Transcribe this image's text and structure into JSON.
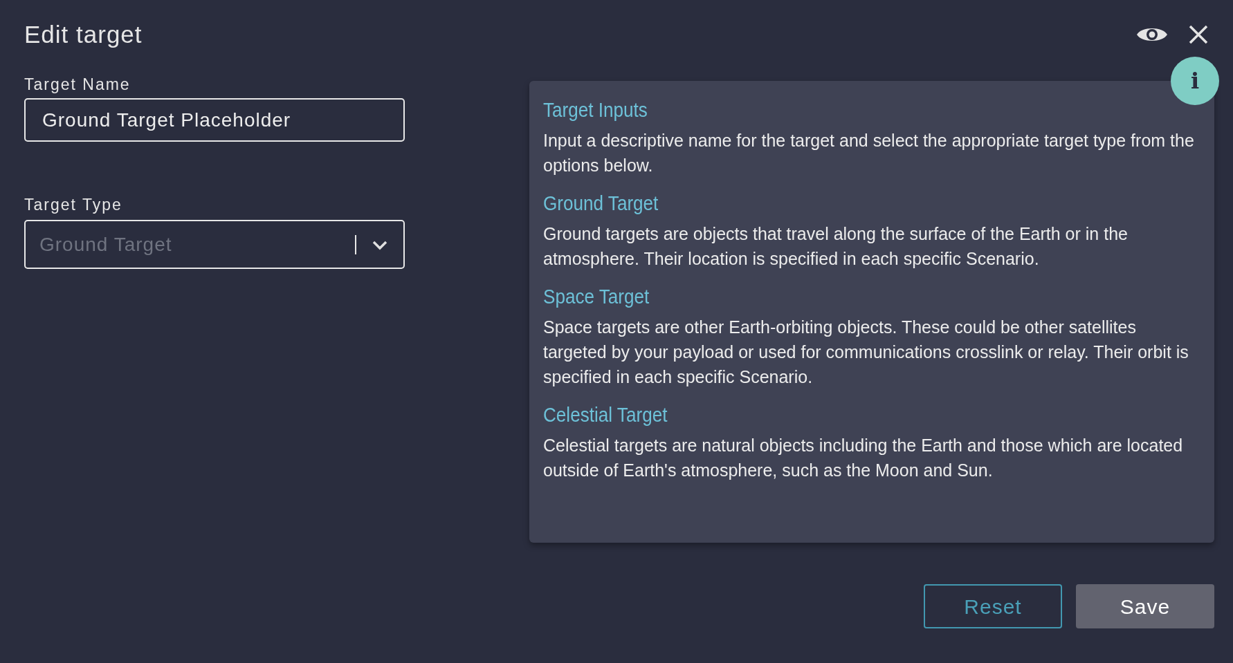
{
  "dialog": {
    "title": "Edit target"
  },
  "fields": [
    {
      "kind": "text",
      "label": "Target Name",
      "value": "Ground Target Placeholder"
    },
    {
      "kind": "select",
      "label": "Target Type",
      "value": "Ground Target",
      "disabled": true
    }
  ],
  "help": {
    "sections": [
      {
        "heading": "Target Inputs",
        "body": "Input a descriptive name for the target and select the appropriate target type from the options below."
      },
      {
        "heading": "Ground Target",
        "body": "Ground targets are objects that travel along the surface of the Earth or in the atmosphere. Their location is specified in each specific Scenario."
      },
      {
        "heading": "Space Target",
        "body": "Space targets are other Earth-orbiting objects. These could be other satellites targeted by your payload or used for communications crosslink or relay. Their orbit is specified in each specific Scenario."
      },
      {
        "heading": "Celestial Target",
        "body": "Celestial targets are natural objects including the Earth and those which are located outside of Earth's atmosphere, such as the Moon and Sun."
      }
    ],
    "badge": "i"
  },
  "buttons": [
    {
      "kind": "outline",
      "label": "Reset"
    },
    {
      "kind": "filled",
      "label": "Save"
    }
  ]
}
